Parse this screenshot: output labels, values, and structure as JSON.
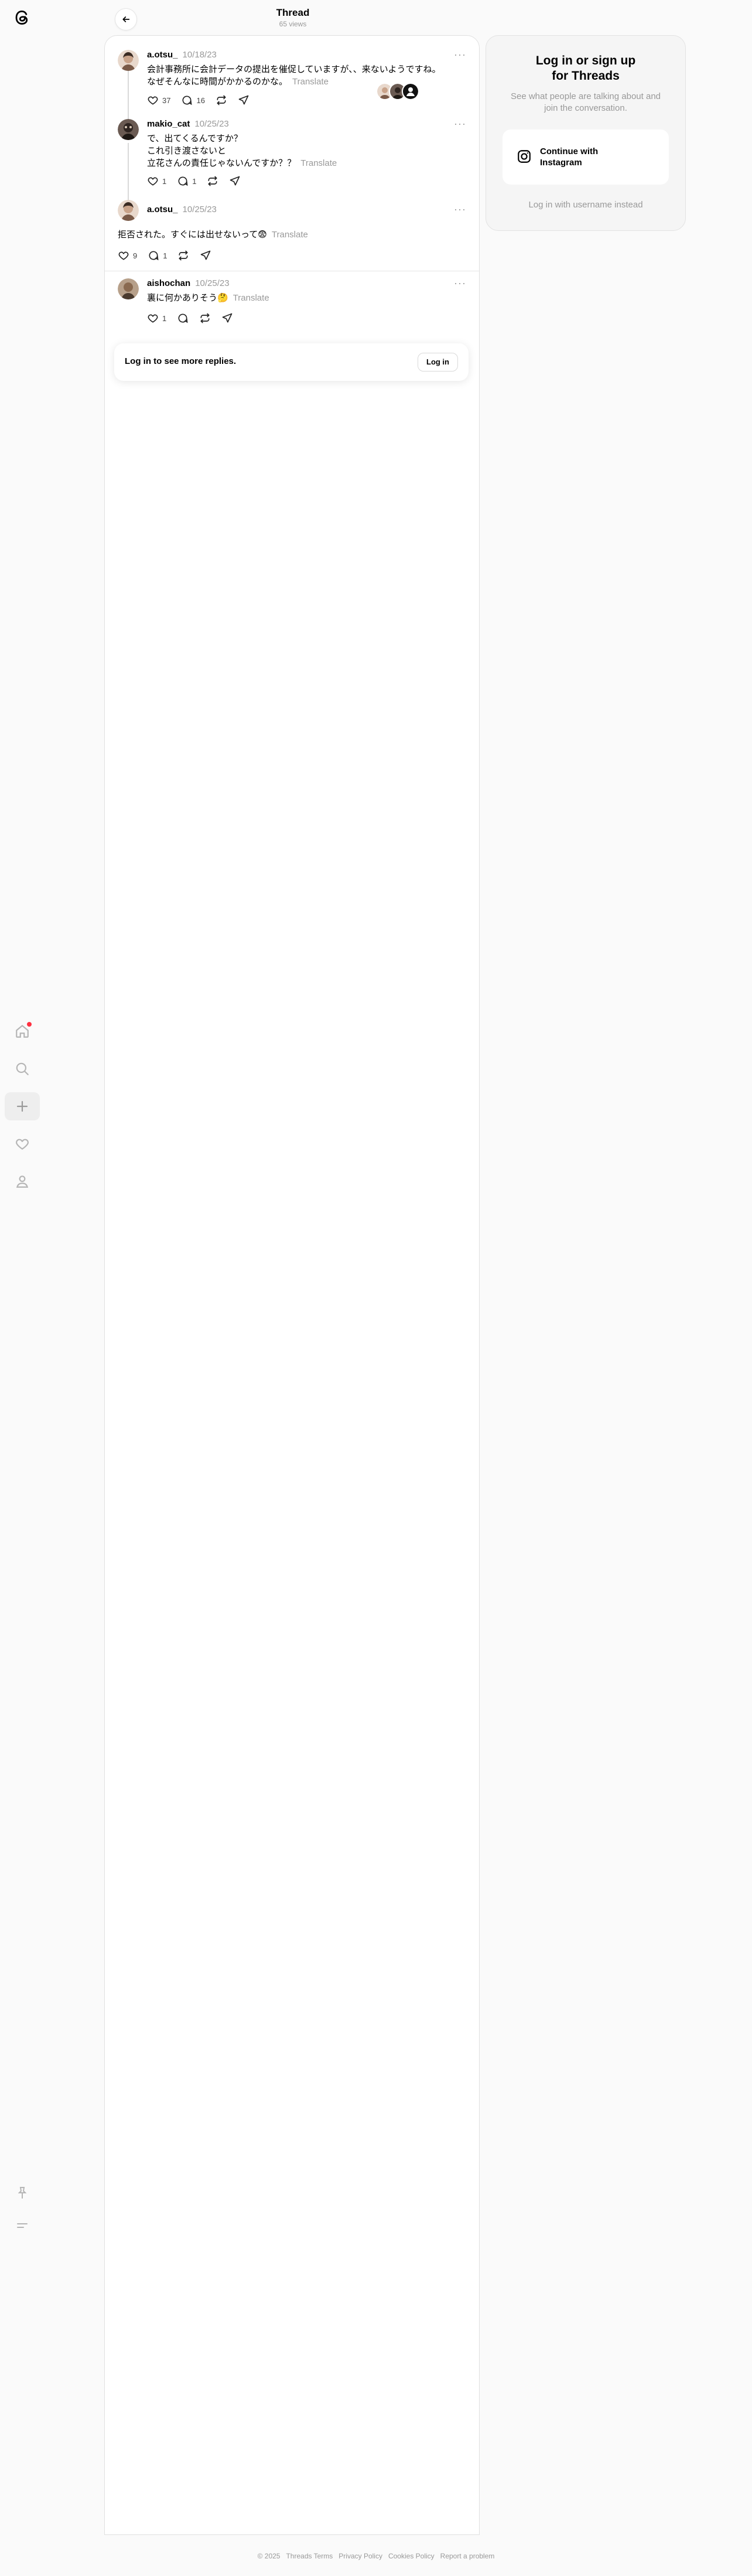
{
  "header": {
    "title": "Thread",
    "views": "65 views"
  },
  "sidebar": {
    "icons": [
      "threads-logo",
      "home-icon",
      "search-icon",
      "plus-icon",
      "heart-icon",
      "profile-icon",
      "pin-icon",
      "menu-icon"
    ],
    "notification_color": "#ff3040"
  },
  "posts": [
    {
      "username": "a.otsu_",
      "time": "10/18/23",
      "lines": [
        "会計事務所に会計データの提出を催促していますが、、来ないようですね。",
        "なぜそんなに時間がかかるのかな。"
      ],
      "translate": "Translate",
      "likes": "37",
      "replies": "16"
    },
    {
      "username": "makio_cat",
      "time": "10/25/23",
      "lines": [
        "で、出てくるんですか？",
        "これ引き渡さないと",
        "立花さんの責任じゃないんですか？？"
      ],
      "translate": "Translate",
      "likes": "1",
      "replies": "1"
    },
    {
      "username": "a.otsu_",
      "time": "10/25/23",
      "lines": [
        "拒否された。すぐには出せないって😨"
      ],
      "translate": "Translate",
      "likes": "9",
      "replies": "1"
    },
    {
      "username": "aishochan",
      "time": "10/25/23",
      "lines": [
        "裏に何かありそう🤔"
      ],
      "translate": "Translate",
      "likes": "1",
      "replies": ""
    }
  ],
  "login_prompt": {
    "text": "Log in to see more replies.",
    "button": "Log in"
  },
  "side": {
    "title_line1": "Log in or sign up",
    "title_line2": "for Threads",
    "subtitle": "See what people are talking about and join the conversation.",
    "instagram_button": "Continue with Instagram",
    "alt_login": "Log in with username instead"
  },
  "footer": [
    "© 2025",
    "Threads Terms",
    "Privacy Policy",
    "Cookies Policy",
    "Report a problem"
  ]
}
